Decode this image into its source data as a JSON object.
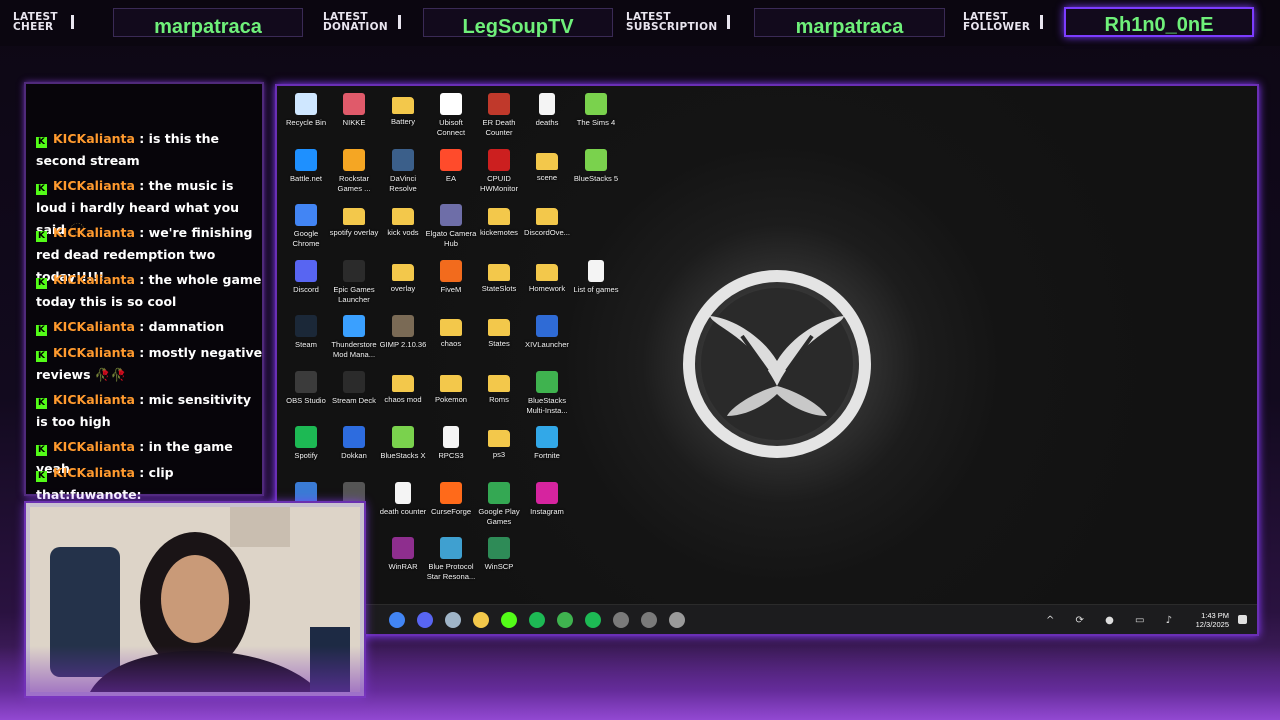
{
  "alerts": [
    {
      "label_line1": "LATEST",
      "label_line2": "CHEER",
      "name": "marpatraca"
    },
    {
      "label_line1": "LATEST",
      "label_line2": "DONATION",
      "name": "LegSoupTV"
    },
    {
      "label_line1": "LATEST",
      "label_line2": "SUBSCRIPTION",
      "name": "marpatraca"
    },
    {
      "label_line1": "LATEST",
      "label_line2": "FOLLOWER",
      "name": "Rh1n0_0nE"
    }
  ],
  "chat": {
    "badge": "K",
    "messages": [
      {
        "user": "KICKalianta",
        "text": " : is this the second stream"
      },
      {
        "user": "KICKalianta",
        "text": " : the music is loud i hardly heard what you said 🫥"
      },
      {
        "user": "KICKalianta",
        "text": " : we're finishing red dead redemption two today!!!!!"
      },
      {
        "user": "KICKalianta",
        "text": " : the whole game today this is so cool"
      },
      {
        "user": "KICKalianta",
        "text": " : damnation"
      },
      {
        "user": "KICKalianta",
        "text": " : mostly negative reviews 🥀🥀"
      },
      {
        "user": "KICKalianta",
        "text": " : mic sensitivity is too high"
      },
      {
        "user": "KICKalianta",
        "text": " : in the game yeah"
      },
      {
        "user": "KICKalianta",
        "text": " : clip that:fuwanote:"
      }
    ]
  },
  "desktop": {
    "icons": [
      [
        "Recycle Bin",
        "NIKKE",
        "Battery",
        "Ubisoft Connect",
        "ER Death Counter",
        "deaths",
        "The Sims 4"
      ],
      [
        "Battle.net",
        "Rockstar Games ...",
        "DaVinci Resolve",
        "EA",
        "CPUID HWMonitor",
        "scene",
        "BlueStacks 5"
      ],
      [
        "Google Chrome",
        "spotify overlay",
        "kick vods",
        "Elgato Camera Hub",
        "kickemotes",
        "DiscordOve...",
        ""
      ],
      [
        "Discord",
        "Epic Games Launcher",
        "overlay",
        "FiveM",
        "StateSlots",
        "Homework",
        "List of games"
      ],
      [
        "Steam",
        "Thunderstore Mod Mana...",
        "GIMP 2.10.36",
        "chaos",
        "States",
        "XIVLauncher",
        ""
      ],
      [
        "OBS Studio",
        "Stream Deck",
        "chaos mod",
        "Pokemon",
        "Roms",
        "BlueStacks Multi-Insta...",
        ""
      ],
      [
        "Spotify",
        "Dokkan",
        "BlueStacks X",
        "RPCS3",
        "ps3",
        "Fortnite",
        ""
      ],
      [
        "",
        "",
        "death counter",
        "CurseForge",
        "Google Play Games",
        "Instagram",
        ""
      ],
      [
        "",
        "",
        "WinRAR",
        "Blue Protocol Star Resona...",
        "WinSCP",
        "",
        ""
      ]
    ],
    "icon_kinds": [
      [
        "recycle",
        "app",
        "folder",
        "app",
        "app",
        "doc",
        "app"
      ],
      [
        "app",
        "app",
        "app",
        "app",
        "app",
        "folder",
        "app"
      ],
      [
        "app",
        "folder",
        "folder",
        "app",
        "folder",
        "folder",
        ""
      ],
      [
        "app",
        "app",
        "folder",
        "app",
        "folder",
        "folder",
        "doc"
      ],
      [
        "app",
        "app",
        "app",
        "folder",
        "folder",
        "app",
        ""
      ],
      [
        "app",
        "app",
        "folder",
        "folder",
        "folder",
        "app",
        ""
      ],
      [
        "app",
        "app",
        "app",
        "doc",
        "folder",
        "app",
        ""
      ],
      [
        "app",
        "app",
        "doc",
        "app",
        "app",
        "app",
        ""
      ],
      [
        "",
        "",
        "app",
        "app",
        "app",
        "",
        ""
      ]
    ],
    "icon_colors": [
      [
        "#cfe7ff",
        "#e05a6a",
        "#f3c84b",
        "#ffffff",
        "#c0392b",
        "#f4f4f4",
        "#7ad24d"
      ],
      [
        "#1e90ff",
        "#f5a623",
        "#3b5f8a",
        "#ff4b2b",
        "#cc1f1f",
        "#f3c84b",
        "#7ad24d"
      ],
      [
        "#4285f4",
        "#f3c84b",
        "#f3c84b",
        "#6e6ea8",
        "#f3c84b",
        "#f3c84b",
        ""
      ],
      [
        "#5865f2",
        "#2b2b2b",
        "#f3c84b",
        "#f26b1d",
        "#f3c84b",
        "#f3c84b",
        "#f4f4f4"
      ],
      [
        "#1b2838",
        "#3aa0ff",
        "#7a6a55",
        "#f3c84b",
        "#f3c84b",
        "#2f6bd6",
        ""
      ],
      [
        "#3b3b3b",
        "#2b2b2b",
        "#f3c84b",
        "#f3c84b",
        "#f3c84b",
        "#3fb34f",
        ""
      ],
      [
        "#1db954",
        "#2d6cdf",
        "#7ad24d",
        "#f4f4f4",
        "#f3c84b",
        "#32a8e8",
        ""
      ],
      [
        "#3a7bd5",
        "#555555",
        "#f4f4f4",
        "#ff6a1a",
        "#34a853",
        "#d6249f",
        ""
      ],
      [
        "",
        "",
        "#8e2e8e",
        "#3fa0d0",
        "#2e8b57",
        "",
        ""
      ]
    ],
    "taskbar": {
      "time": "1:43 PM",
      "date": "12/3/2025",
      "app_colors": [
        "#4285f4",
        "#5865f2",
        "#9fb4c8",
        "#f3c84b",
        "#53fc18",
        "#1db954",
        "#3fb34f",
        "#1db954",
        "#7a7a7a",
        "#7a7a7a",
        "#9a9a9a"
      ]
    }
  }
}
